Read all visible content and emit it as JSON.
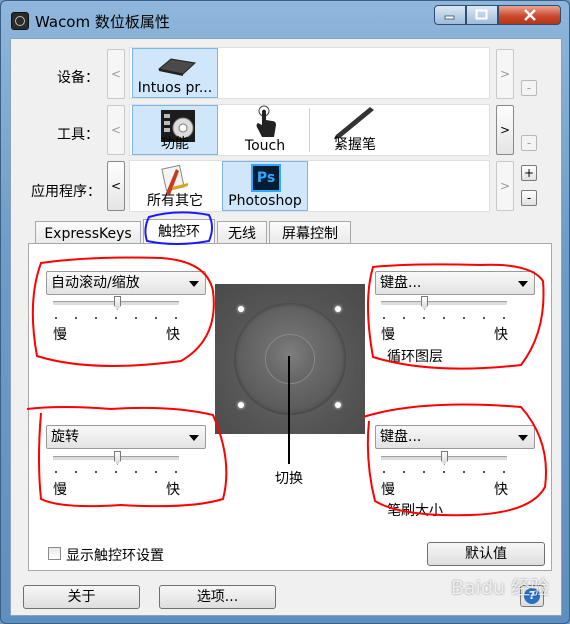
{
  "window": {
    "title": "Wacom 数位板属性"
  },
  "rows": {
    "device": {
      "label": "设备：",
      "items": [
        {
          "label": "Intuos pr...",
          "icon": "tablet-icon"
        }
      ]
    },
    "tool": {
      "label": "工具：",
      "items": [
        {
          "label": "功能",
          "icon": "express-keys-icon"
        },
        {
          "label": "Touch",
          "icon": "touch-hand-icon"
        },
        {
          "label": "紧握笔",
          "icon": "pen-icon"
        }
      ]
    },
    "application": {
      "label": "应用程序：",
      "items": [
        {
          "label": "所有其它",
          "icon": "all-apps-icon"
        },
        {
          "label": "Photoshop",
          "icon": "photoshop-icon",
          "badge": "Ps"
        }
      ]
    }
  },
  "tabs": [
    "ExpressKeys",
    "触控环",
    "无线",
    "屏幕控制"
  ],
  "active_tab": "触控环",
  "touch_ring": {
    "top_left": {
      "dropdown": "自动滚动/缩放",
      "slow": "慢",
      "fast": "快",
      "level": 0.4
    },
    "top_right": {
      "dropdown": "键盘...",
      "slow": "慢",
      "fast": "快",
      "caption": "循环图层",
      "level": 0.4
    },
    "bottom_left": {
      "dropdown": "旋转",
      "slow": "慢",
      "fast": "快",
      "level": 0.5
    },
    "bottom_right": {
      "dropdown": "键盘...",
      "slow": "慢",
      "fast": "快",
      "caption": "笔刷大小",
      "level": 0.5
    },
    "center_label": "切换"
  },
  "show_settings_checkbox": {
    "label": "显示触控环设置",
    "checked": false
  },
  "buttons": {
    "default": "默认值",
    "about": "关于",
    "options": "选项..."
  },
  "watermark": "Baidu 经验",
  "colors": {
    "annotation_red": "#ff0000",
    "annotation_blue": "#1a1aff",
    "selected_tile": "#cfe6fb",
    "photoshop_badge": "#001d34"
  }
}
